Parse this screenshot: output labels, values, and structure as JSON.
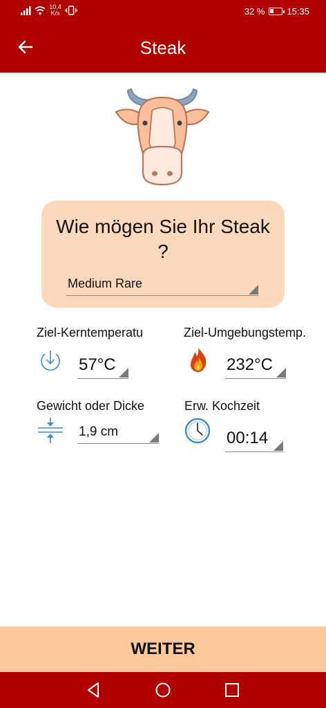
{
  "status_bar": {
    "net_speed_value": "10,4",
    "net_speed_unit": "K/s",
    "battery_percent": "32 %",
    "battery_level": 0.32,
    "time": "15:35"
  },
  "app_bar": {
    "title": "Steak",
    "back_icon": "arrow-left-icon"
  },
  "header_image": "cow-head-icon",
  "prompt": {
    "question": "Wie mögen Sie Ihr Steak ?",
    "selected_doneness": "Medium Rare"
  },
  "fields": {
    "core_temp": {
      "label": "Ziel-Kerntemperatu",
      "value": "57°C",
      "icon": "thermometer-arrow-down-icon"
    },
    "ambient_temp": {
      "label": "Ziel-Umgebungstemp.",
      "value": "232°C",
      "icon": "flame-icon"
    },
    "weight": {
      "label": "Gewicht oder Dicke",
      "value": "1,9 cm",
      "icon": "thickness-icon"
    },
    "cook_time": {
      "label": "Erw. Kochzeit",
      "value": "00:14",
      "icon": "clock-icon"
    }
  },
  "next_button": {
    "label": "WEITER"
  },
  "colors": {
    "primary": "#b00000",
    "card": "#fcd9bc",
    "button": "#fdc99a"
  }
}
